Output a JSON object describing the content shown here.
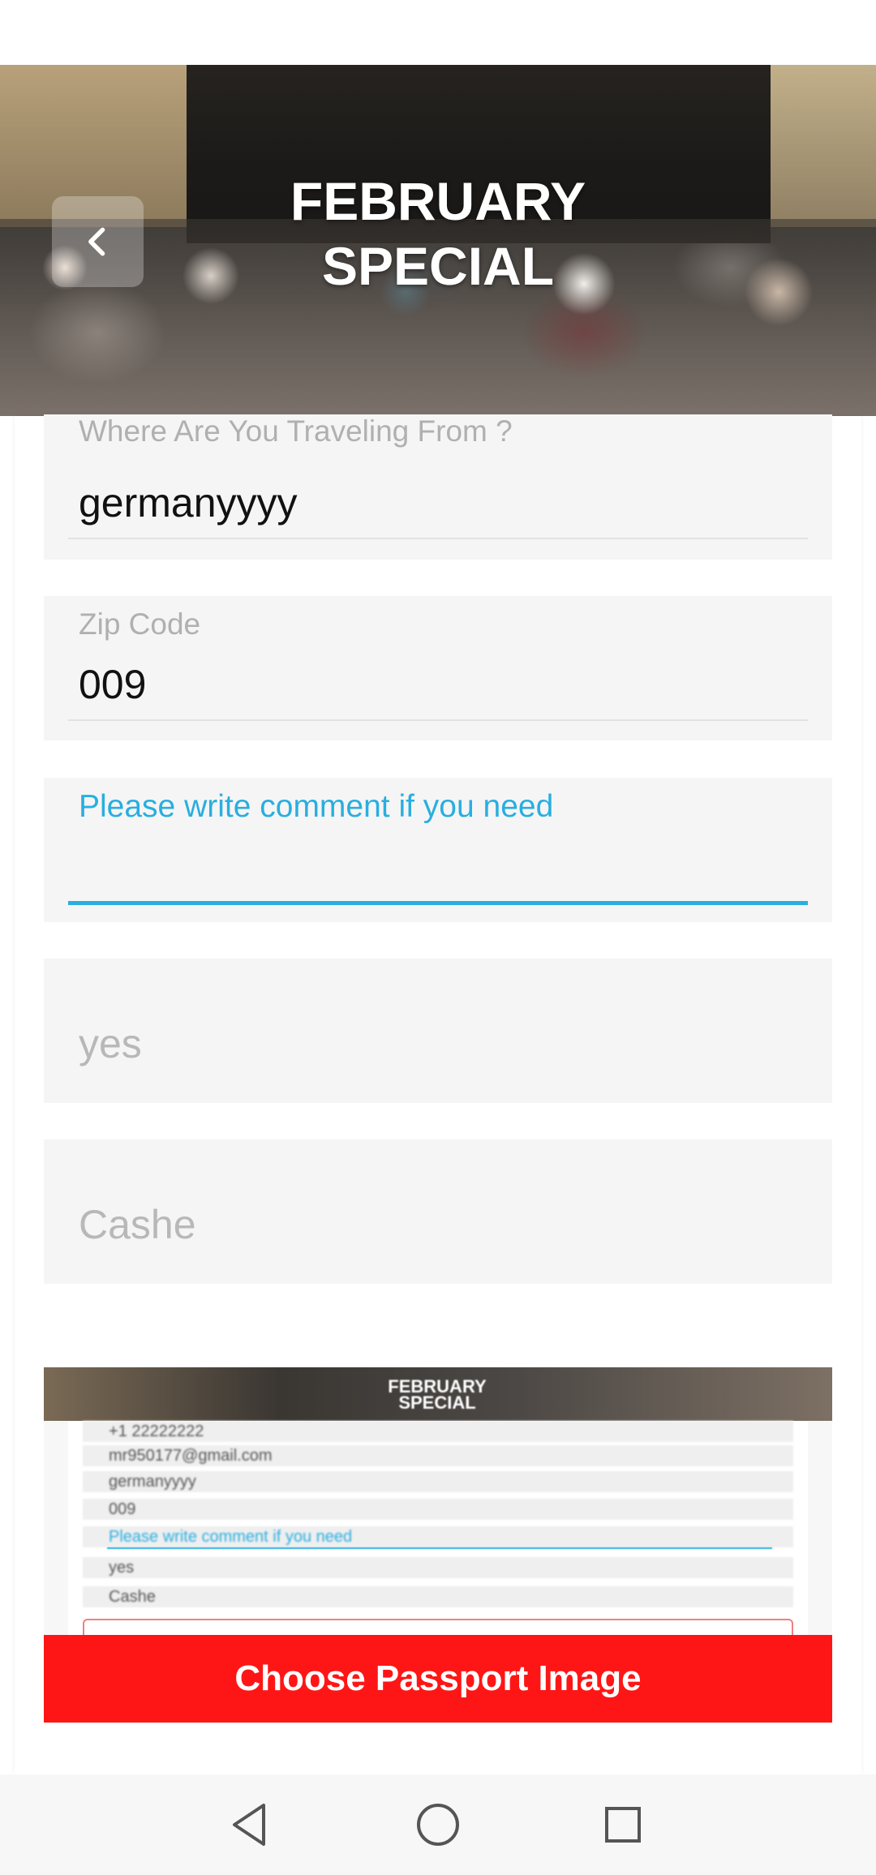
{
  "header": {
    "title_line1": "FEBRUARY",
    "title_line2": "SPECIAL",
    "back_icon": "chevron-left-icon"
  },
  "form": {
    "traveling_from": {
      "label": "Where Are You Traveling From ?",
      "value": "germanyyyy"
    },
    "zip_code": {
      "label": "Zip Code",
      "value": "009"
    },
    "comment": {
      "label": "Please write comment if you need",
      "value": ""
    },
    "answer_field": {
      "placeholder": "yes"
    },
    "payment_field": {
      "placeholder": "Cashe"
    }
  },
  "passport_preview": {
    "title_line1": "FEBRUARY",
    "title_line2": "SPECIAL",
    "rows": [
      "+1  22222222",
      "mr950177@gmail.com",
      "germanyyyy",
      "009",
      "Please write comment if you need",
      "yes",
      "Cashe"
    ]
  },
  "actions": {
    "choose_passport_label": "Choose Passport Image"
  },
  "nav": {
    "back_icon": "triangle-back-icon",
    "home_icon": "circle-home-icon",
    "recent_icon": "square-recent-icon"
  },
  "colors": {
    "accent_blue": "#29aee0",
    "button_red": "#fe1616",
    "field_bg": "#f5f5f5"
  }
}
